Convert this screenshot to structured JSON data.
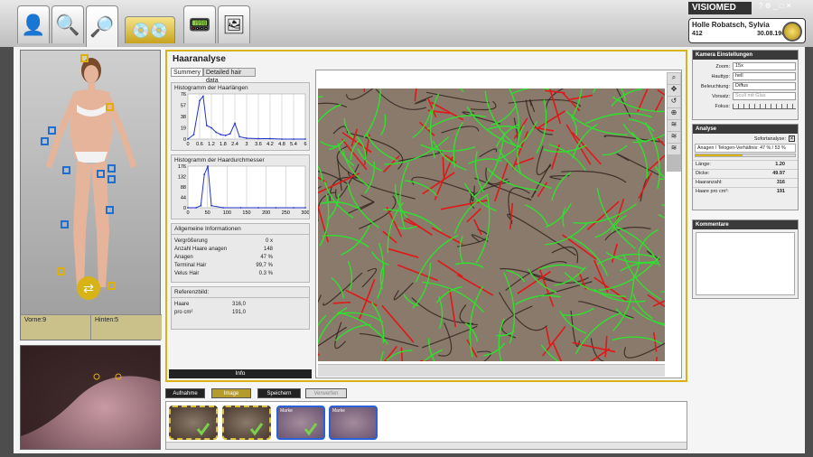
{
  "brand": {
    "name": "VISIOMED"
  },
  "patient": {
    "name": "Holle Robatsch, Sylvia",
    "id": "412",
    "dob": "30.08.1968"
  },
  "body_panel": {
    "front": "Vorne:9",
    "back": "Hinten:5"
  },
  "viewer": {
    "title": "Haaranalyse",
    "tabs": [
      "Summery",
      "Detailed hair data"
    ]
  },
  "hist1": {
    "title": "Histogramm der Haarlängen",
    "yticks": [
      "76",
      "57",
      "38",
      "19",
      "0"
    ],
    "xticks": [
      "0",
      "0.6",
      "1.2",
      "1.8",
      "2.4",
      "3",
      "3.6",
      "4.2",
      "4.8",
      "5.4",
      "6"
    ]
  },
  "hist2": {
    "title": "Histogramm der Haardurchmesser",
    "yticks": [
      "176",
      "132",
      "88",
      "44",
      "0"
    ],
    "xticks": [
      "0",
      "50",
      "100",
      "150",
      "200",
      "250",
      "300"
    ]
  },
  "general": {
    "title": "Allgemeine Informationen",
    "rows": [
      {
        "label": "Vergrößerung",
        "value": "0 x"
      },
      {
        "label": "Anzahl Haare anagen",
        "value": "148"
      },
      {
        "label": "Anagen",
        "value": "47 %"
      },
      {
        "label": "Terminal Hair",
        "value": "99,7 %"
      },
      {
        "label": "Velus Hair",
        "value": "0.3 %"
      }
    ]
  },
  "reference": {
    "title": "Referenzbild:",
    "rows": [
      {
        "label": "Haare",
        "value": "316,0"
      },
      {
        "label": "pro cm²",
        "value": "191,0"
      }
    ]
  },
  "info_button": "Info",
  "camera": {
    "title": "Kamera Einstellungen",
    "rows": [
      {
        "label": "Zoom:",
        "value": "15x"
      },
      {
        "label": "Hauttyp:",
        "value": "hell"
      },
      {
        "label": "Beleuchtung:",
        "value": "Diffus"
      },
      {
        "label": "Vorsatz:",
        "value": "Scull mit Glas"
      },
      {
        "label": "Fokus:",
        "value": ""
      }
    ]
  },
  "analyse": {
    "title": "Analyse",
    "auto_label": "Sofortanalyse:",
    "ratio_label": "Anagen / Telogen-Verhältnis: 47 % / 53 %",
    "ratio": 0.47,
    "rows": [
      {
        "label": "Länge:",
        "value": "1.20"
      },
      {
        "label": "Dicke:",
        "value": "49.97"
      },
      {
        "label": "Haaranzahl:",
        "value": "316"
      },
      {
        "label": "Haare pro cm²:",
        "value": "191"
      }
    ]
  },
  "comments": {
    "title": "Kommentare"
  },
  "actions": {
    "capture": "Aufnahme",
    "image": "Image",
    "save": "Speichern",
    "discard": "Verwerfen"
  },
  "thumbs": [
    {
      "label": "",
      "checked": true
    },
    {
      "label": "",
      "checked": true
    },
    {
      "label": "Marke",
      "checked": true
    },
    {
      "label": "Marke",
      "checked": false
    }
  ],
  "colors": {
    "accent_gold": "#d8b318",
    "hair_green": "#2fe02f",
    "hair_red": "#e01818",
    "marker_blue": "#1e6fd1"
  }
}
